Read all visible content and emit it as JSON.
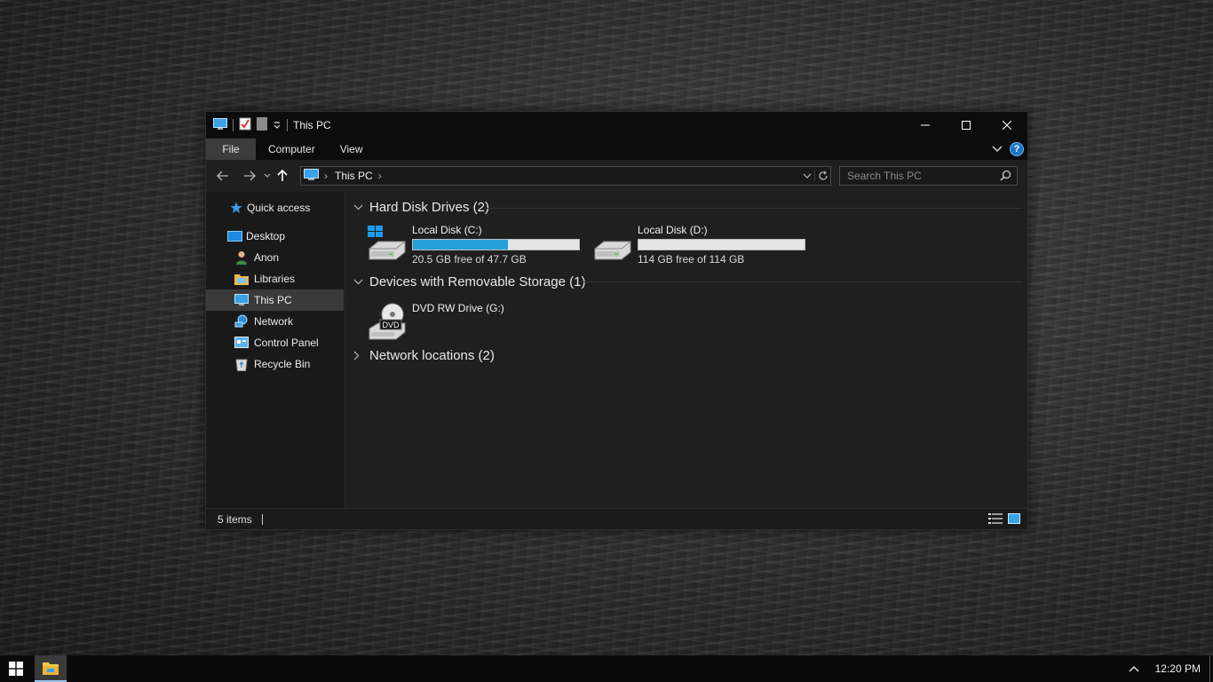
{
  "window": {
    "title": "This PC",
    "controls": {
      "minimize": "minimize-icon",
      "maximize": "maximize-icon",
      "close": "close-icon"
    }
  },
  "ribbon": {
    "tabs": [
      "File",
      "Computer",
      "View"
    ]
  },
  "address": {
    "crumb": "This PC",
    "search_placeholder": "Search This PC"
  },
  "sidebar": {
    "items": [
      {
        "label": "Quick access",
        "icon": "star-icon"
      },
      {
        "label": "Desktop",
        "icon": "desktop-icon"
      },
      {
        "label": "Anon",
        "icon": "user-icon"
      },
      {
        "label": "Libraries",
        "icon": "library-icon"
      },
      {
        "label": "This PC",
        "icon": "computer-icon",
        "selected": true
      },
      {
        "label": "Network",
        "icon": "network-icon"
      },
      {
        "label": "Control Panel",
        "icon": "control-panel-icon"
      },
      {
        "label": "Recycle Bin",
        "icon": "recycle-bin-icon"
      }
    ]
  },
  "groups": {
    "hdd": {
      "title": "Hard Disk Drives (2)",
      "expanded": true
    },
    "removable": {
      "title": "Devices with Removable Storage (1)",
      "expanded": true
    },
    "network": {
      "title": "Network locations (2)",
      "expanded": false
    }
  },
  "drives": [
    {
      "name": "Local Disk (C:)",
      "free": "20.5 GB free of 47.7 GB",
      "used_fraction": 0.57,
      "icon": "system-drive-icon"
    },
    {
      "name": "Local Disk (D:)",
      "free": "114 GB free of 114 GB",
      "used_fraction": 0.0,
      "icon": "hard-drive-icon"
    }
  ],
  "removable_drives": [
    {
      "name": "DVD RW Drive (G:)",
      "icon": "dvd-drive-icon",
      "badge": "DVD"
    }
  ],
  "status": {
    "count": "5 items"
  },
  "taskbar": {
    "clock": "12:20 PM"
  },
  "colors": {
    "accent": "#26a0da",
    "window_bg": "#1f1f1f",
    "titlebar_bg": "#0c0c0c"
  }
}
